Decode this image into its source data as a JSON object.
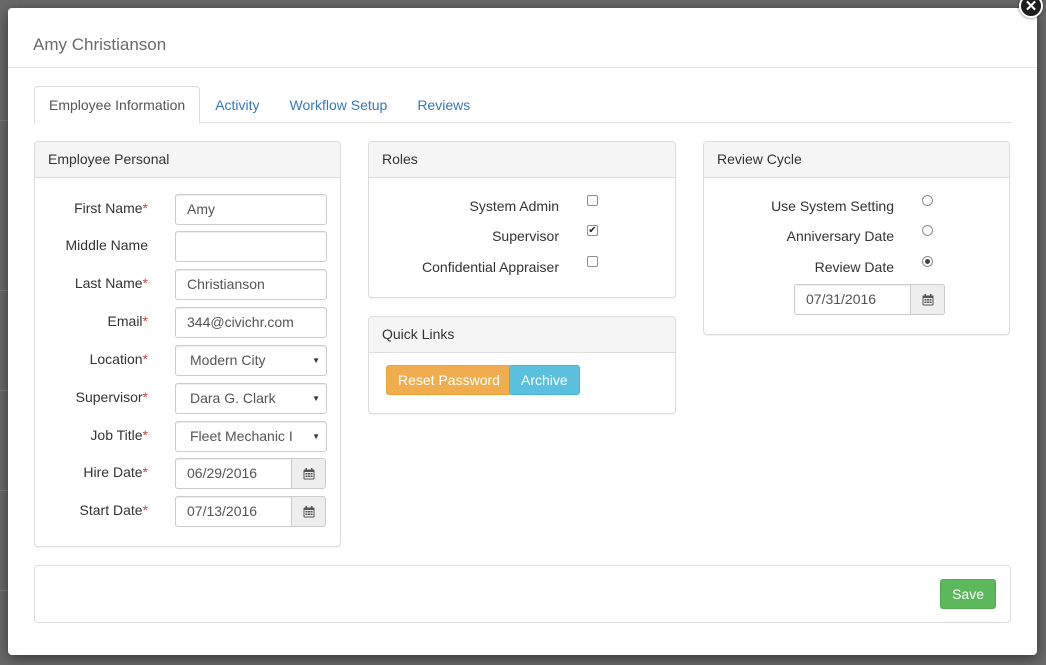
{
  "modal": {
    "title": "Amy Christianson",
    "close_glyph": "✕"
  },
  "tabs": [
    {
      "label": "Employee Information",
      "active": true
    },
    {
      "label": "Activity",
      "active": false
    },
    {
      "label": "Workflow Setup",
      "active": false
    },
    {
      "label": "Reviews",
      "active": false
    }
  ],
  "employee_personal": {
    "heading": "Employee Personal",
    "required_mark": "*",
    "first_name": {
      "label": "First Name",
      "value": "Amy"
    },
    "middle_name": {
      "label": "Middle Name",
      "value": ""
    },
    "last_name": {
      "label": "Last Name",
      "value": "Christianson"
    },
    "email": {
      "label": "Email",
      "value": "344@civichr.com"
    },
    "location": {
      "label": "Location",
      "value": "Modern City"
    },
    "supervisor": {
      "label": "Supervisor",
      "value": "Dara G. Clark"
    },
    "job_title": {
      "label": "Job Title",
      "value": "Fleet Mechanic I"
    },
    "hire_date": {
      "label": "Hire Date",
      "value": "06/29/2016"
    },
    "start_date": {
      "label": "Start Date",
      "value": "07/13/2016"
    },
    "select_caret": "▼"
  },
  "roles": {
    "heading": "Roles",
    "items": [
      {
        "label": "System Admin",
        "checked": false
      },
      {
        "label": "Supervisor",
        "checked": true
      },
      {
        "label": "Confidential Appraiser",
        "checked": false
      }
    ],
    "check_glyph": "✔"
  },
  "quick_links": {
    "heading": "Quick Links",
    "reset_password": "Reset Password",
    "archive": "Archive"
  },
  "review_cycle": {
    "heading": "Review Cycle",
    "options": [
      {
        "label": "Use System Setting",
        "selected": false
      },
      {
        "label": "Anniversary Date",
        "selected": false
      },
      {
        "label": "Review Date",
        "selected": true
      }
    ],
    "review_date": "07/31/2016"
  },
  "footer": {
    "save": "Save"
  },
  "colors": {
    "link": "#337ab7",
    "warning": "#f0ad4e",
    "info": "#5bc0de",
    "success": "#5cb85c",
    "required": "#b94a48"
  },
  "icons": {
    "calendar": "calendar-icon",
    "close": "close-icon",
    "dropdown": "caret-down-icon"
  }
}
